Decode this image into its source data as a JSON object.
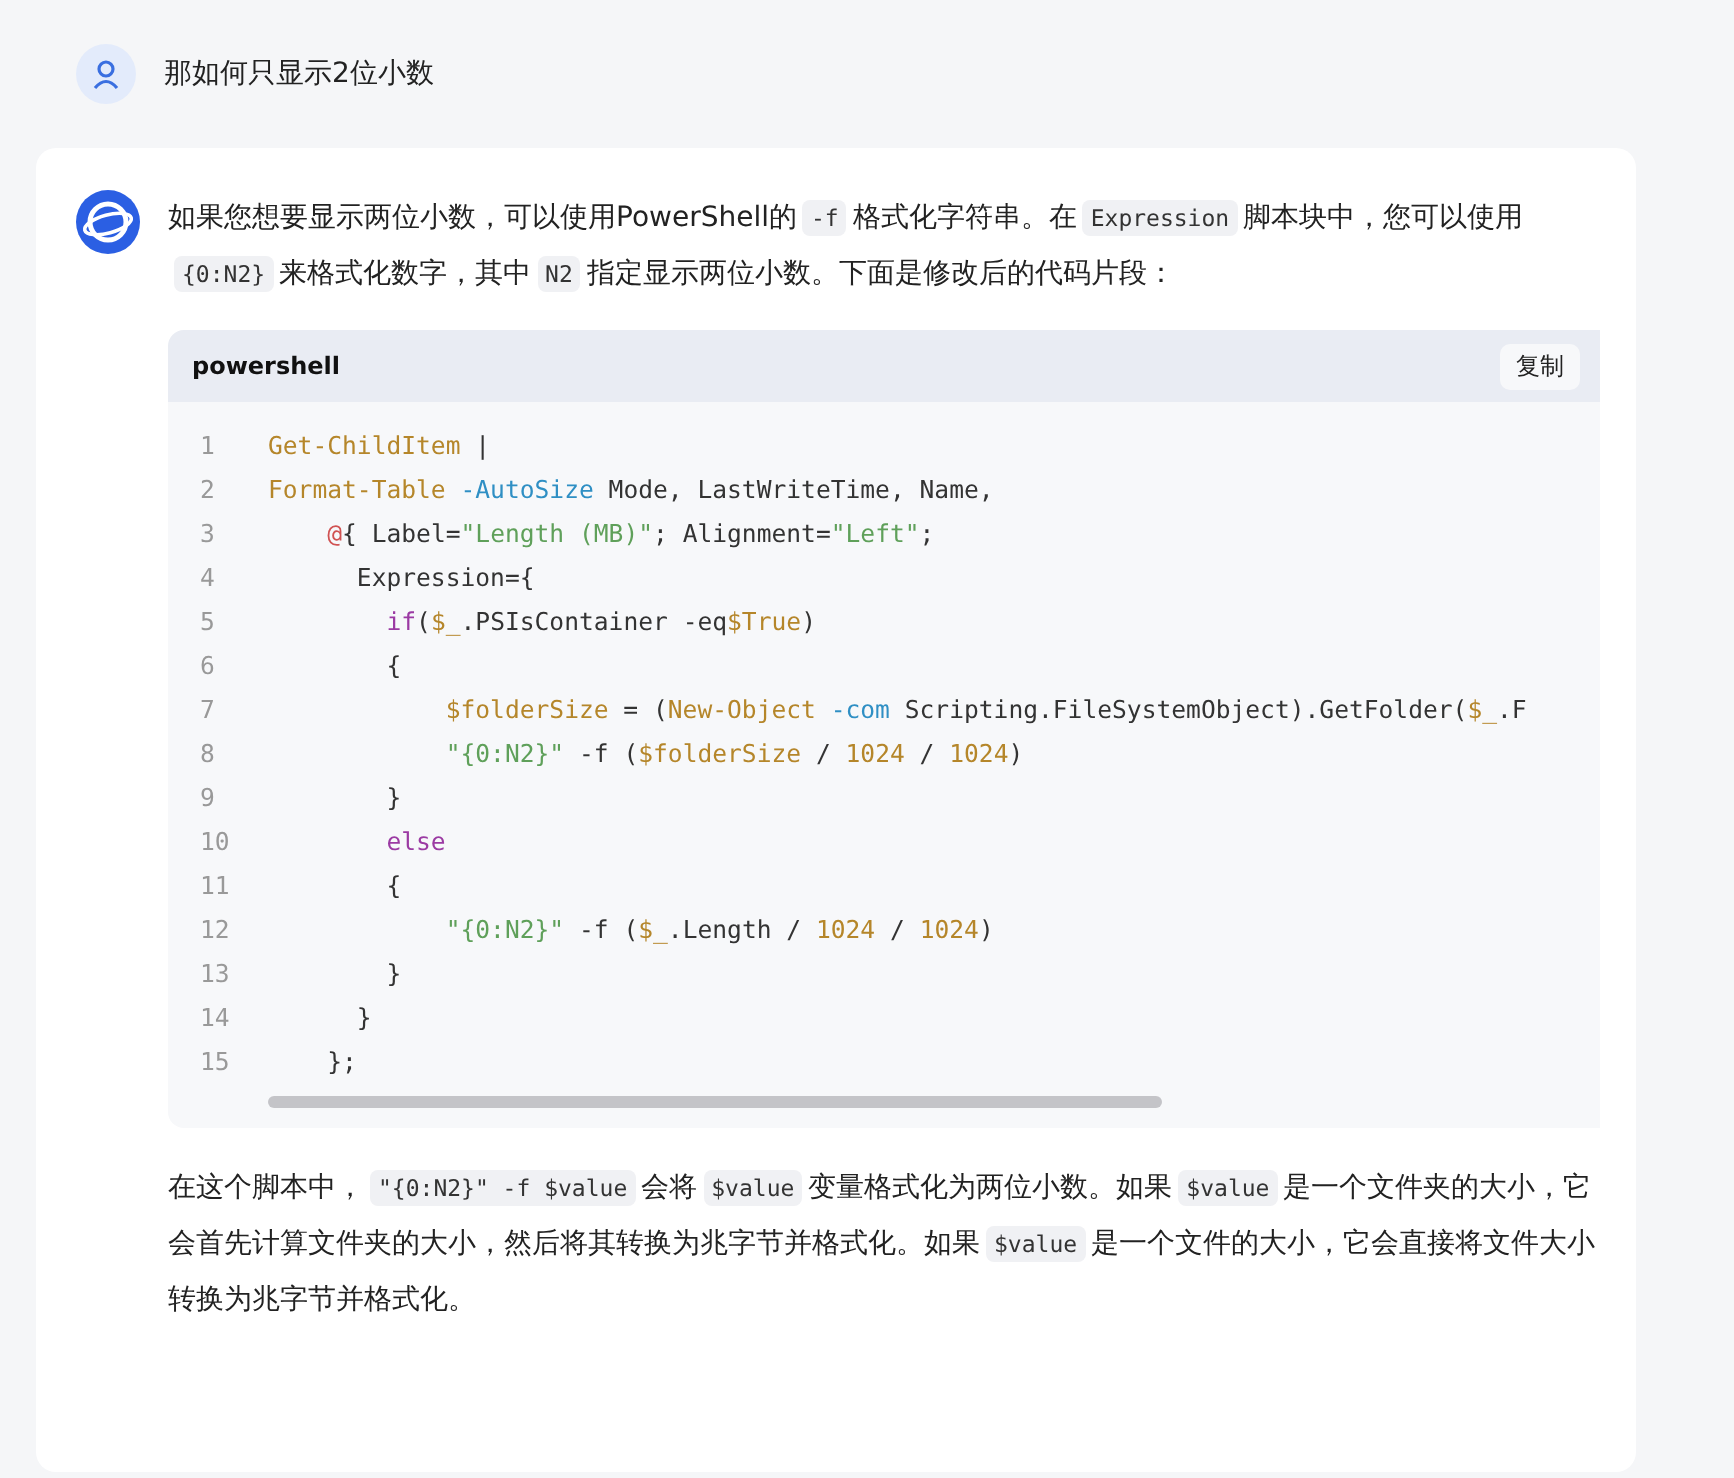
{
  "question": {
    "text": "那如何只显示2位小数"
  },
  "answer": {
    "paragraphs": [
      [
        {
          "kind": "text",
          "text": "如果您想要显示两位小数，可以使用PowerShell的"
        },
        {
          "kind": "code",
          "text": "-f"
        },
        {
          "kind": "text",
          "text": "格式化字符串。在"
        },
        {
          "kind": "code",
          "text": "Expression"
        },
        {
          "kind": "text",
          "text": "脚本块中，您可以使用"
        },
        {
          "kind": "code",
          "text": "{0:N2}"
        },
        {
          "kind": "text",
          "text": "来格式化数字，其中"
        },
        {
          "kind": "code",
          "text": "N2"
        },
        {
          "kind": "text",
          "text": "指定显示两位小数。下面是修改后的代码片段："
        }
      ]
    ],
    "code_block": {
      "language": "powershell",
      "copy_button": "复制",
      "lines": [
        {
          "number": "1",
          "tokens": [
            {
              "kind": "cmd",
              "text": "Get-ChildItem"
            },
            {
              "kind": "plain",
              "text": " |"
            }
          ]
        },
        {
          "number": "2",
          "tokens": [
            {
              "kind": "cmd",
              "text": "Format-Table "
            },
            {
              "kind": "param",
              "text": "-AutoSize"
            },
            {
              "kind": "plain",
              "text": " Mode, LastWriteTime, Name,"
            }
          ]
        },
        {
          "number": "3",
          "tokens": [
            {
              "kind": "at",
              "text": "    @"
            },
            {
              "kind": "plain",
              "text": "{ Label="
            },
            {
              "kind": "str",
              "text": "\"Length (MB)\""
            },
            {
              "kind": "plain",
              "text": "; Alignment="
            },
            {
              "kind": "str",
              "text": "\"Left\""
            },
            {
              "kind": "plain",
              "text": ";"
            }
          ]
        },
        {
          "number": "4",
          "tokens": [
            {
              "kind": "plain",
              "text": "      Expression={"
            }
          ]
        },
        {
          "number": "5",
          "tokens": [
            {
              "kind": "kw",
              "text": "        if"
            },
            {
              "kind": "plain",
              "text": "("
            },
            {
              "kind": "cmd",
              "text": "$_"
            },
            {
              "kind": "plain",
              "text": ".PSIsContainer -eq"
            },
            {
              "kind": "cmd",
              "text": "$True"
            },
            {
              "kind": "plain",
              "text": ")"
            }
          ]
        },
        {
          "number": "6",
          "tokens": [
            {
              "kind": "plain",
              "text": "        {"
            }
          ]
        },
        {
          "number": "7",
          "tokens": [
            {
              "kind": "cmd",
              "text": "            $folderSize"
            },
            {
              "kind": "plain",
              "text": " = ("
            },
            {
              "kind": "cmd",
              "text": "New-Object "
            },
            {
              "kind": "param",
              "text": "-com"
            },
            {
              "kind": "plain",
              "text": " Scripting.FileSystemObject).GetFolder("
            },
            {
              "kind": "cmd",
              "text": "$_"
            },
            {
              "kind": "plain",
              "text": ".F"
            }
          ]
        },
        {
          "number": "8",
          "tokens": [
            {
              "kind": "str",
              "text": "            \"{0:N2}\""
            },
            {
              "kind": "plain",
              "text": " -f ("
            },
            {
              "kind": "cmd",
              "text": "$folderSize"
            },
            {
              "kind": "plain",
              "text": " / "
            },
            {
              "kind": "cmd",
              "text": "1024"
            },
            {
              "kind": "plain",
              "text": " / "
            },
            {
              "kind": "cmd",
              "text": "1024"
            },
            {
              "kind": "plain",
              "text": ")"
            }
          ]
        },
        {
          "number": "9",
          "tokens": [
            {
              "kind": "plain",
              "text": "        }"
            }
          ]
        },
        {
          "number": "10",
          "tokens": [
            {
              "kind": "kw",
              "text": "        else"
            }
          ]
        },
        {
          "number": "11",
          "tokens": [
            {
              "kind": "plain",
              "text": "        {"
            }
          ]
        },
        {
          "number": "12",
          "tokens": [
            {
              "kind": "str",
              "text": "            \"{0:N2}\""
            },
            {
              "kind": "plain",
              "text": " -f ("
            },
            {
              "kind": "cmd",
              "text": "$_"
            },
            {
              "kind": "plain",
              "text": ".Length / "
            },
            {
              "kind": "cmd",
              "text": "1024"
            },
            {
              "kind": "plain",
              "text": " / "
            },
            {
              "kind": "cmd",
              "text": "1024"
            },
            {
              "kind": "plain",
              "text": ")"
            }
          ]
        },
        {
          "number": "13",
          "tokens": [
            {
              "kind": "plain",
              "text": "        }"
            }
          ]
        },
        {
          "number": "14",
          "tokens": [
            {
              "kind": "plain",
              "text": "      }"
            }
          ]
        },
        {
          "number": "15",
          "tokens": [
            {
              "kind": "plain",
              "text": "    };"
            }
          ]
        }
      ]
    },
    "after_paragraphs": [
      [
        {
          "kind": "text",
          "text": "在这个脚本中，"
        },
        {
          "kind": "code",
          "text": "\"{0:N2}\" -f $value"
        },
        {
          "kind": "text",
          "text": "会将"
        },
        {
          "kind": "code",
          "text": "$value"
        },
        {
          "kind": "text",
          "text": "变量格式化为两位小数。如果"
        },
        {
          "kind": "code",
          "text": "$value"
        },
        {
          "kind": "text",
          "text": "是一个文件夹的大小，它会首先计算文件夹的大小，然后将其转换为兆字节并格式化。如果"
        },
        {
          "kind": "code",
          "text": "$value"
        },
        {
          "kind": "text",
          "text": "是一个文件的大小，它会直接将文件大小转换为兆字节并格式化。"
        }
      ]
    ]
  }
}
